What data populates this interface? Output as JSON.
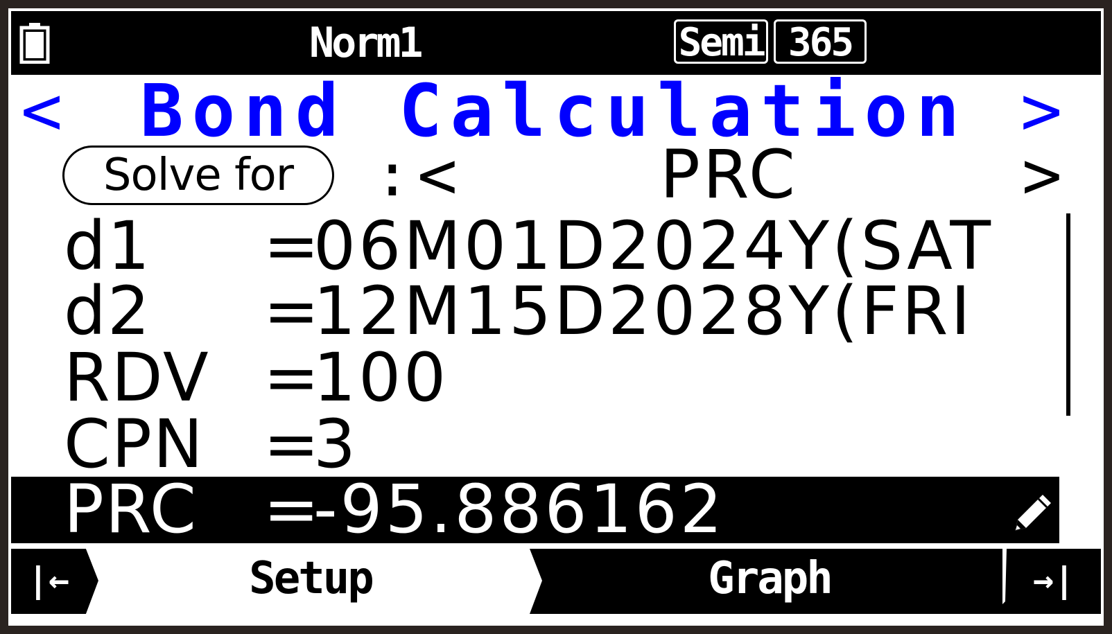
{
  "status_bar": {
    "mode": "Norm1",
    "badges": [
      "Semi",
      "365"
    ],
    "icons": [
      "battery-icon"
    ]
  },
  "title": {
    "text": "Bond Calculation",
    "left_arrow": "<",
    "right_arrow": ">"
  },
  "solve_for": {
    "label": "Solve for",
    "separator": ":",
    "left_arrow": "<",
    "value": "PRC",
    "right_arrow": ">"
  },
  "variables": [
    {
      "name": "d1",
      "eq": "=",
      "value": "06M01D2024Y(SAT"
    },
    {
      "name": "d2",
      "eq": "=",
      "value": "12M15D2028Y(FRI"
    },
    {
      "name": "RDV",
      "eq": "=",
      "value": "100"
    },
    {
      "name": "CPN",
      "eq": "=",
      "value": "3"
    },
    {
      "name": "PRC",
      "eq": "=",
      "value": "-95.886162",
      "selected": true
    }
  ],
  "function_keys": {
    "left": "|←",
    "setup": "Setup",
    "graph": "Graph",
    "right": "→|"
  },
  "colors": {
    "title": "#0000ff",
    "background": "#ffffff",
    "bezel": "#2a2320",
    "inverse": "#000000"
  }
}
